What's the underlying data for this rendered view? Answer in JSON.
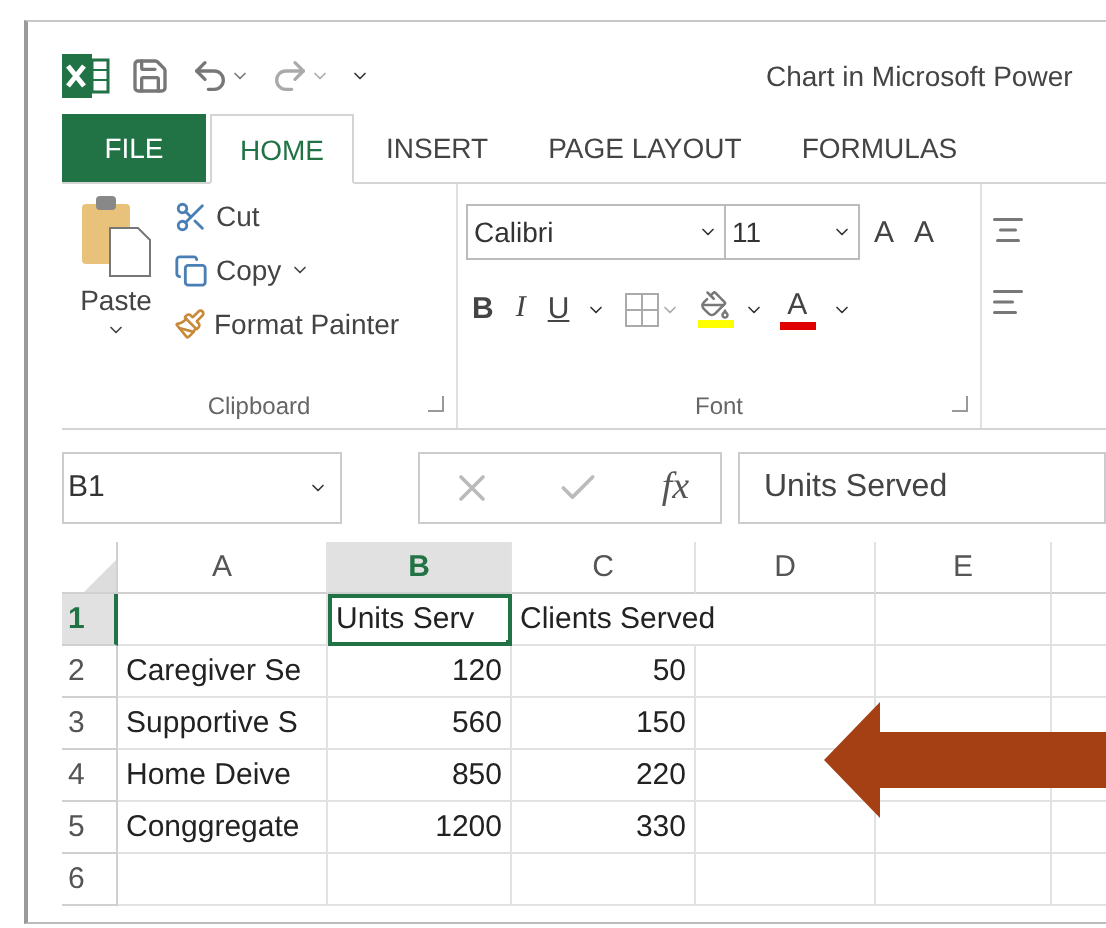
{
  "title_bar": {
    "title": "Chart in Microsoft Power"
  },
  "tabs": [
    {
      "label": "FILE",
      "kind": "file",
      "selected": false
    },
    {
      "label": "HOME",
      "kind": "tab",
      "selected": true
    },
    {
      "label": "INSERT",
      "kind": "tab",
      "selected": false
    },
    {
      "label": "PAGE LAYOUT",
      "kind": "tab",
      "selected": false
    },
    {
      "label": "FORMULAS",
      "kind": "tab",
      "selected": false
    }
  ],
  "clipboard": {
    "paste": "Paste",
    "cut": "Cut",
    "copy": "Copy",
    "format_painter": "Format Painter",
    "group_label": "Clipboard"
  },
  "font": {
    "font_name": "Calibri",
    "font_size": "11",
    "grow": "A",
    "shrink": "A",
    "bold": "B",
    "italic": "I",
    "underline": "U",
    "font_color": "A",
    "group_label": "Font"
  },
  "formula_bar": {
    "name_box": "B1",
    "fx": "fx",
    "value": "Units Served"
  },
  "sheet": {
    "columns": [
      {
        "label": "A",
        "selected": false
      },
      {
        "label": "B",
        "selected": true
      },
      {
        "label": "C",
        "selected": false
      },
      {
        "label": "D",
        "selected": false
      },
      {
        "label": "E",
        "selected": false
      }
    ],
    "rows": [
      {
        "label": "1",
        "selected": true,
        "cells": [
          {
            "kind": "empty",
            "selected": false
          },
          {
            "kind": "text",
            "text": "Units Serv",
            "selected": true
          },
          {
            "kind": "text",
            "text": "Clients Served",
            "selected": false
          }
        ]
      },
      {
        "label": "2",
        "selected": false,
        "cells": [
          {
            "kind": "text",
            "text": "Caregiver Se",
            "selected": false
          },
          {
            "kind": "number",
            "text": "120",
            "selected": false
          },
          {
            "kind": "number",
            "text": "50",
            "selected": false
          }
        ]
      },
      {
        "label": "3",
        "selected": false,
        "cells": [
          {
            "kind": "text",
            "text": "Supportive S",
            "selected": false
          },
          {
            "kind": "number",
            "text": "560",
            "selected": false
          },
          {
            "kind": "number",
            "text": "150",
            "selected": false
          }
        ]
      },
      {
        "label": "4",
        "selected": false,
        "cells": [
          {
            "kind": "text",
            "text": "Home Deive",
            "selected": false
          },
          {
            "kind": "number",
            "text": "850",
            "selected": false
          },
          {
            "kind": "number",
            "text": "220",
            "selected": false
          }
        ]
      },
      {
        "label": "5",
        "selected": false,
        "cells": [
          {
            "kind": "text",
            "text": "Conggregate",
            "selected": false
          },
          {
            "kind": "number",
            "text": "1200",
            "selected": false
          },
          {
            "kind": "number",
            "text": "330",
            "selected": false
          }
        ]
      },
      {
        "label": "6",
        "selected": false,
        "cells": []
      }
    ]
  }
}
